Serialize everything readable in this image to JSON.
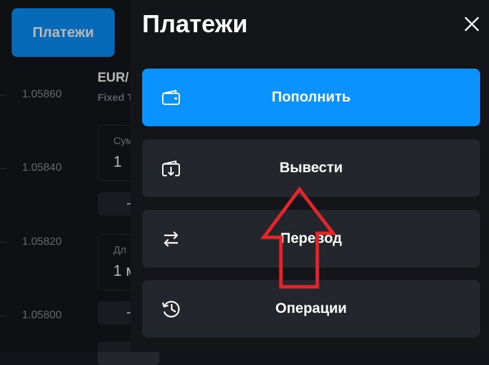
{
  "background": {
    "payments_button_label": "Платежи",
    "price_axis": [
      "1.05860",
      "1.05840",
      "1.05820",
      "1.05800"
    ],
    "asset": {
      "name": "EUR/",
      "subtitle": "Fixed T"
    },
    "fields": [
      {
        "label": "Сум",
        "value": "1"
      },
      {
        "label": "Дл",
        "value": "1 м"
      }
    ]
  },
  "panel": {
    "title": "Платежи",
    "close_icon": "close-icon",
    "items": [
      {
        "label": "Пополнить",
        "icon": "wallet-icon"
      },
      {
        "label": "Вывести",
        "icon": "withdraw-icon"
      },
      {
        "label": "Перевод",
        "icon": "transfer-arrows-icon"
      },
      {
        "label": "Операции",
        "icon": "history-icon"
      }
    ]
  },
  "colors": {
    "accent": "#0a93ff",
    "panel_bg": "#141519",
    "button_bg": "#24262d",
    "annotation": "#e4262b"
  }
}
